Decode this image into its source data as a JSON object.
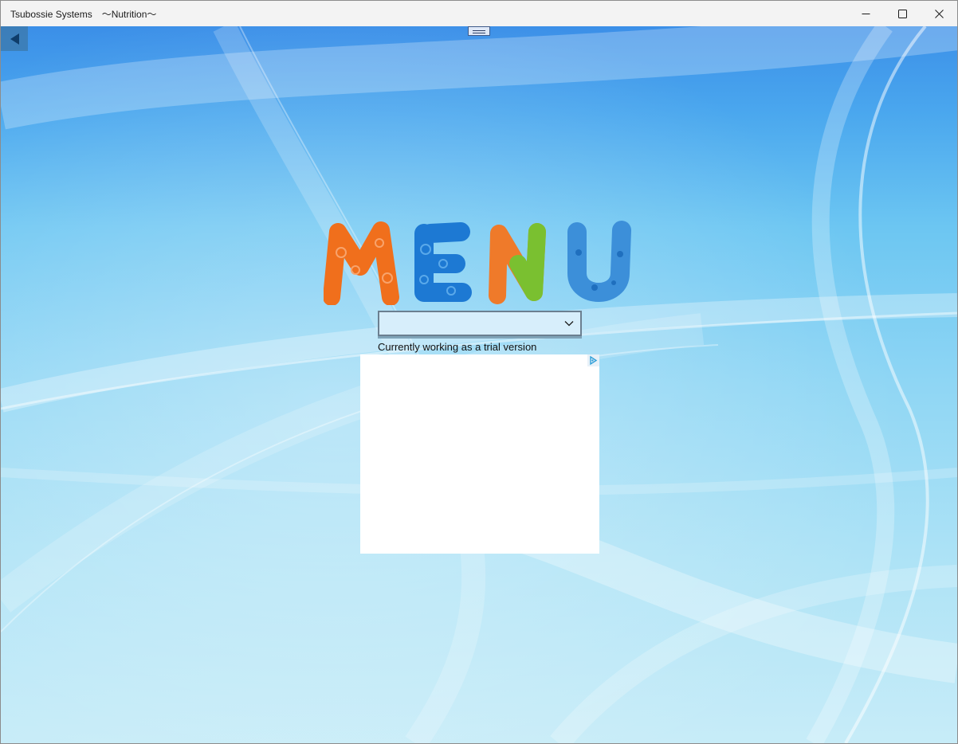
{
  "window": {
    "title": "Tsubossie Systems　〜Nutrition〜",
    "controls": [
      "minimize-icon",
      "maximize-icon",
      "close-icon"
    ]
  },
  "toolbar": {
    "back_icon": "back-arrow-icon",
    "grip_icon": "drag-handle-icon"
  },
  "logo": {
    "text": "MENU",
    "letter_colors": [
      "#f06f1c",
      "#1d79d3",
      "#ef7a2a",
      "#3c8fd9"
    ],
    "accent_green": "#7ac030"
  },
  "menu": {
    "selected_value": "",
    "dropdown_icon": "chevron-down-icon"
  },
  "status": {
    "trial_text": "Currently working as a trial version"
  },
  "ad": {
    "choices_icon": "ad-choices-icon"
  }
}
